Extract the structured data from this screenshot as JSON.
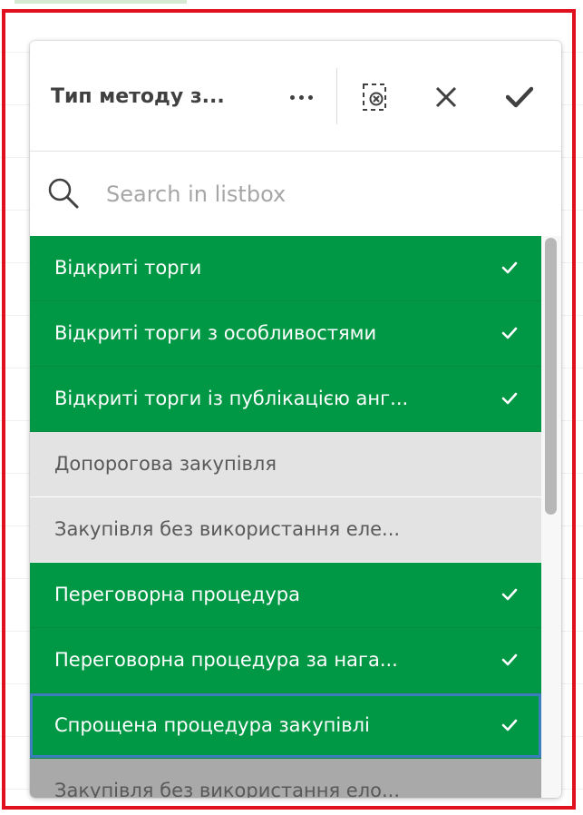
{
  "colors": {
    "selected": "#009845",
    "alternative": "#e3e3e3",
    "excluded": "#a9a9a9",
    "frame": "#e0101e",
    "focus": "#3c7dbe"
  },
  "listbox": {
    "title": "Тип методу з...",
    "more_icon": "more-dots-icon",
    "clear_icon": "clear-selections-icon",
    "close_icon": "close-icon",
    "confirm_icon": "checkmark-icon"
  },
  "search": {
    "placeholder": "Search in listbox",
    "value": "",
    "icon": "search-icon"
  },
  "items": [
    {
      "label": "Відкриті торги",
      "state": "selected"
    },
    {
      "label": "Відкриті торги з особливостями",
      "state": "selected"
    },
    {
      "label": "Відкриті торги із публікацією анг...",
      "state": "selected"
    },
    {
      "label": "Допорогова закупівля",
      "state": "alternative"
    },
    {
      "label": "Закупівля без використання еле...",
      "state": "alternative"
    },
    {
      "label": "Переговорна процедура",
      "state": "selected"
    },
    {
      "label": "Переговорна процедура за нага...",
      "state": "selected"
    },
    {
      "label": "Спрощена процедура закупівлі",
      "state": "selected",
      "focused": true
    },
    {
      "label": "Закупівля без використання ело...",
      "state": "excluded"
    }
  ]
}
